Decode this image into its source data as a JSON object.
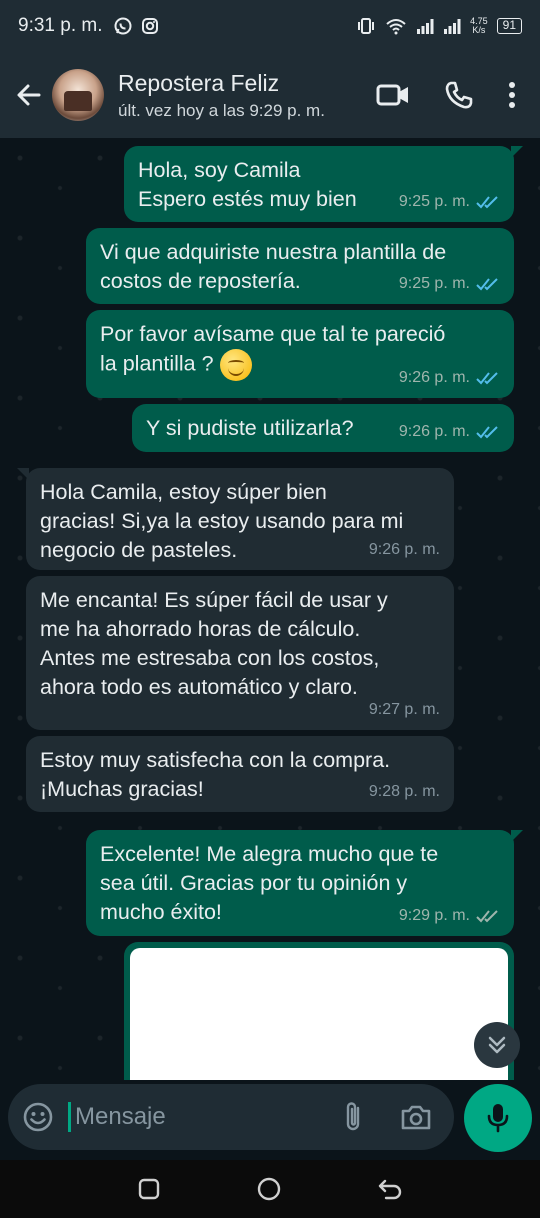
{
  "status_bar": {
    "time": "9:31 p. m.",
    "network_speed_value": "4.75",
    "network_speed_unit": "K/s",
    "battery": "91"
  },
  "header": {
    "contact_name": "Repostera Feliz",
    "last_seen": "últ. vez hoy a las 9:29 p. m."
  },
  "messages": [
    {
      "direction": "out",
      "text": "Hola, soy Camila\nEspero estés muy bien",
      "time": "9:25 p. m.",
      "status": "read"
    },
    {
      "direction": "out",
      "text": "Vi que adquiriste nuestra plantilla de\ncostos de repostería.",
      "time": "9:25 p. m.",
      "status": "read"
    },
    {
      "direction": "out",
      "text": "Por favor avísame que tal te pareció\nla plantilla ?",
      "time": "9:26 p. m.",
      "status": "read",
      "emoji": "smiling-face-emoji"
    },
    {
      "direction": "out",
      "text": "Y si pudiste utilizarla?",
      "time": "9:26 p. m.",
      "status": "read"
    },
    {
      "direction": "in",
      "text": "Hola Camila, estoy súper bien\ngracias! Si,ya la estoy usando para mi\nnegocio de pasteles.",
      "time": "9:26 p. m."
    },
    {
      "direction": "in",
      "text": "Me encanta! Es súper fácil de usar y\nme ha ahorrado horas de cálculo.\nAntes me estresaba con los costos,\nahora todo es automático y claro.",
      "time": "9:27 p. m."
    },
    {
      "direction": "in",
      "text": "Estoy muy satisfecha con la compra.\n¡Muchas gracias!",
      "time": "9:28 p. m."
    },
    {
      "direction": "out",
      "text": "Excelente! Me alegra mucho que te\nsea útil. Gracias por tu opinión y\nmucho éxito!",
      "time": "9:29 p. m.",
      "status": "delivered"
    }
  ],
  "composer": {
    "placeholder": "Mensaje"
  },
  "colors": {
    "outgoing_bubble": "#005c4b",
    "incoming_bubble": "#202c33",
    "accent": "#00a884",
    "read_ticks": "#53bdeb"
  }
}
